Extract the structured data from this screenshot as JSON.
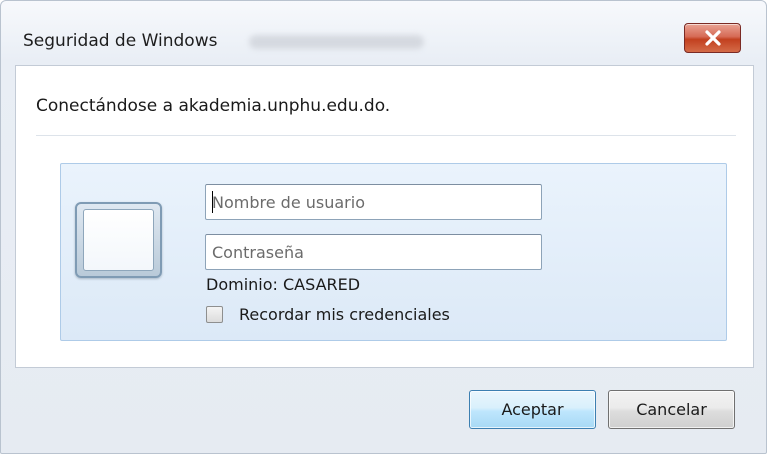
{
  "window": {
    "title": "Seguridad de Windows",
    "close_icon": "close-icon"
  },
  "dialog": {
    "connecting_text": "Conectándose a akademia.unphu.edu.do.",
    "username": {
      "value": "",
      "placeholder": "Nombre de usuario"
    },
    "password": {
      "value": "",
      "placeholder": "Contraseña"
    },
    "domain_text": "Dominio: CASARED",
    "remember_label": "Recordar mis credenciales",
    "remember_checked": false,
    "user_tile_icon": "user-tile-icon"
  },
  "buttons": {
    "ok_label": "Aceptar",
    "cancel_label": "Cancelar"
  },
  "colors": {
    "close_button": "#c2401f",
    "panel_background": "#dce9f7",
    "default_button_border": "#3c7fb1"
  }
}
